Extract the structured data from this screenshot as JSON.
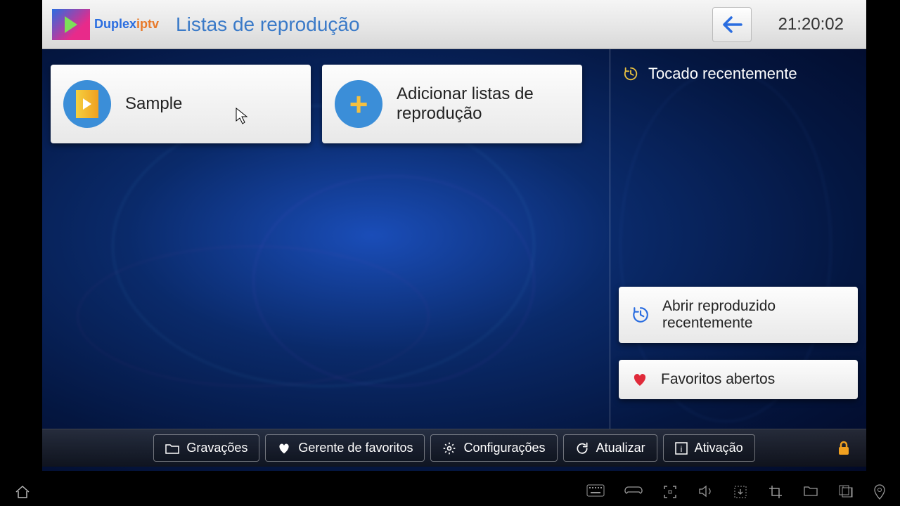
{
  "brand": {
    "part1": "Duplex",
    "part2": "iptv"
  },
  "header": {
    "title": "Listas de reprodução",
    "clock": "21:20:02"
  },
  "cards": {
    "sample": "Sample",
    "add": "Adicionar listas de reprodução"
  },
  "side": {
    "recent_title": "Tocado recentemente",
    "open_recent": "Abrir reproduzido recentemente",
    "favorites": "Favoritos abertos"
  },
  "bottom": {
    "recordings": "Gravações",
    "fav_manager": "Gerente de favoritos",
    "settings": "Configurações",
    "refresh": "Atualizar",
    "activation": "Ativação"
  }
}
